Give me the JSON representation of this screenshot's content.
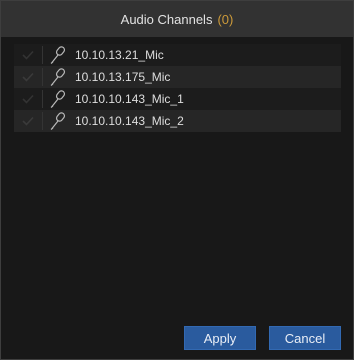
{
  "dialog": {
    "title": "Audio Channels",
    "count": "(0)"
  },
  "channels": [
    {
      "label": "10.10.13.21_Mic",
      "checked": false,
      "icon": "microphone-icon"
    },
    {
      "label": "10.10.13.175_Mic",
      "checked": false,
      "icon": "microphone-icon"
    },
    {
      "label": "10.10.10.143_Mic_1",
      "checked": false,
      "icon": "microphone-icon"
    },
    {
      "label": "10.10.10.143_Mic_2",
      "checked": false,
      "icon": "microphone-icon"
    }
  ],
  "buttons": {
    "apply": "Apply",
    "cancel": "Cancel"
  },
  "colors": {
    "title_count": "#cc9a3a",
    "button": "#2a5b9e",
    "background": "#181818"
  }
}
